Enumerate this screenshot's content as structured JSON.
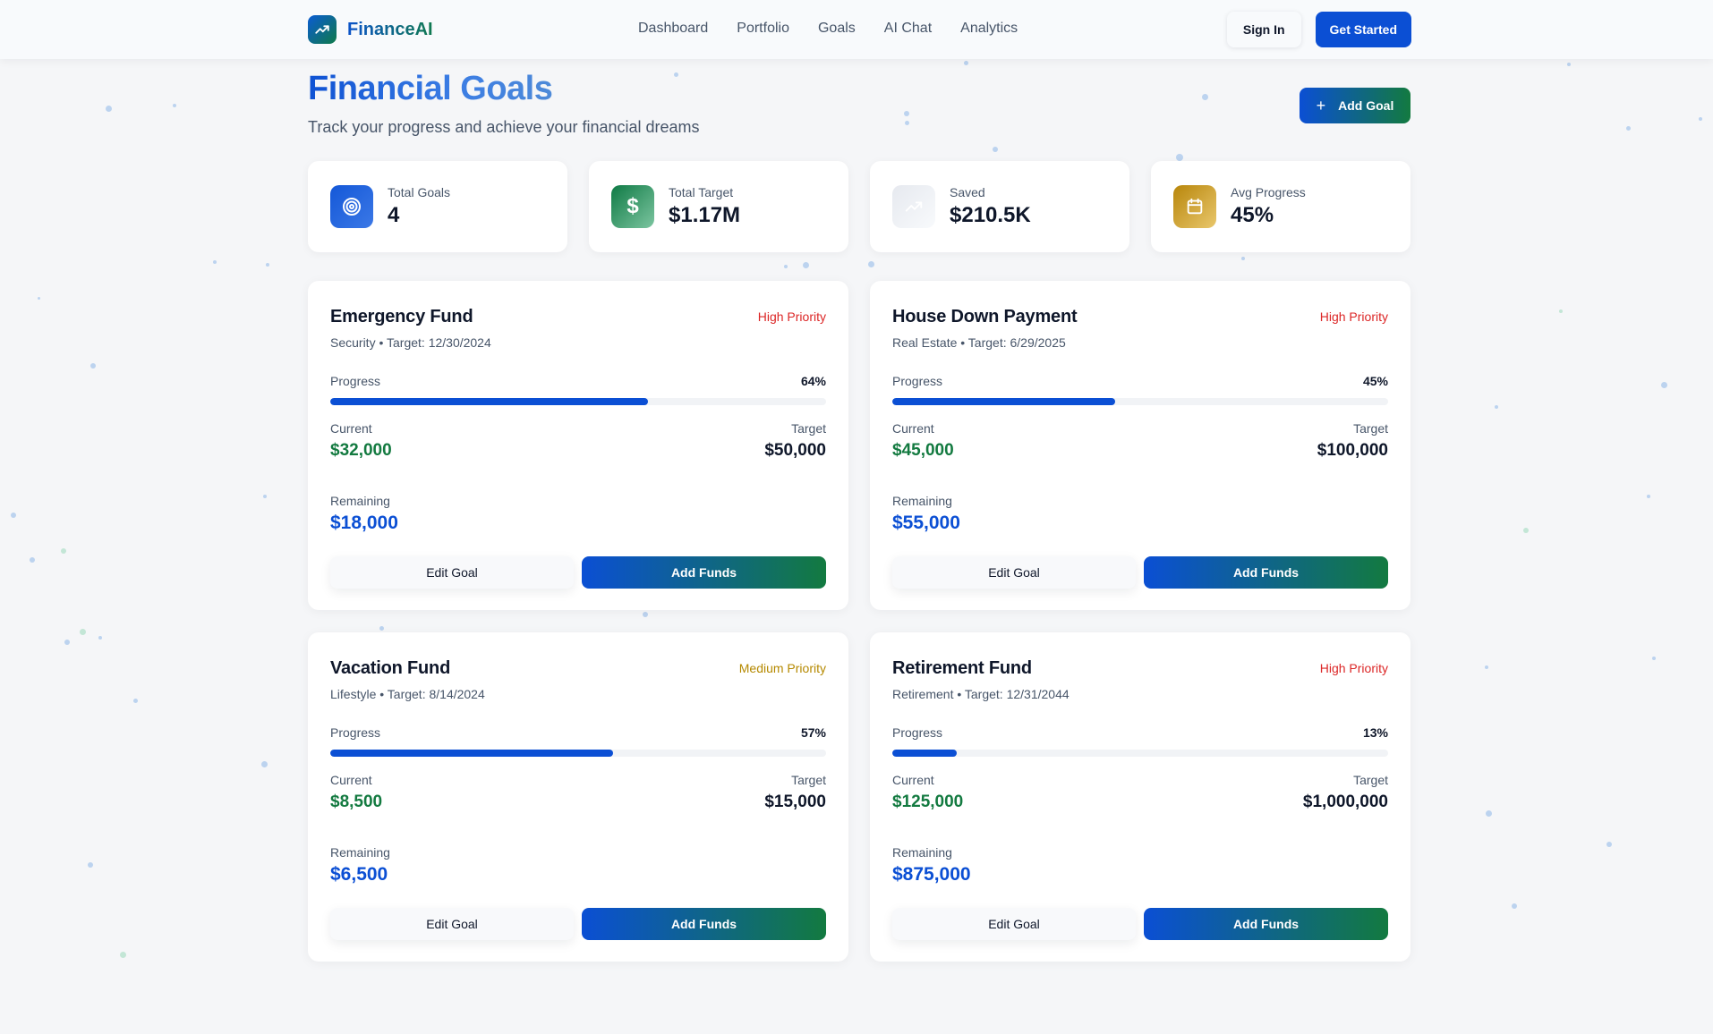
{
  "nav": {
    "brand": "FinanceAI",
    "links": [
      "Dashboard",
      "Portfolio",
      "Goals",
      "AI Chat",
      "Analytics"
    ],
    "sign_in": "Sign In",
    "get_started": "Get Started"
  },
  "header": {
    "title": "Financial Goals",
    "subtitle": "Track your progress and achieve your financial dreams",
    "add_goal": "Add Goal"
  },
  "stats": [
    {
      "label": "Total Goals",
      "value": "4",
      "icon": "target-icon"
    },
    {
      "label": "Total Target",
      "value": "$1.17M",
      "icon": "dollar-icon"
    },
    {
      "label": "Saved",
      "value": "$210.5K",
      "icon": "trending-up-icon"
    },
    {
      "label": "Avg Progress",
      "value": "45%",
      "icon": "calendar-icon"
    }
  ],
  "goals": [
    {
      "name": "Emergency Fund",
      "priority": "High Priority",
      "priority_color": "#dc2626",
      "meta": "Security • Target: 12/30/2024",
      "progress_label": "Progress",
      "progress_pct": "64%",
      "progress": 0.64,
      "current_label": "Current",
      "current": "$32,000",
      "target_label": "Target",
      "target": "$50,000",
      "remaining_label": "Remaining",
      "remaining": "$18,000",
      "edit": "Edit Goal",
      "fund": "Add Funds"
    },
    {
      "name": "House Down Payment",
      "priority": "High Priority",
      "priority_color": "#dc2626",
      "meta": "Real Estate • Target: 6/29/2025",
      "progress_label": "Progress",
      "progress_pct": "45%",
      "progress": 0.45,
      "current_label": "Current",
      "current": "$45,000",
      "target_label": "Target",
      "target": "$100,000",
      "remaining_label": "Remaining",
      "remaining": "$55,000",
      "edit": "Edit Goal",
      "fund": "Add Funds"
    },
    {
      "name": "Vacation Fund",
      "priority": "Medium Priority",
      "priority_color": "#b58900",
      "meta": "Lifestyle • Target: 8/14/2024",
      "progress_label": "Progress",
      "progress_pct": "57%",
      "progress": 0.57,
      "current_label": "Current",
      "current": "$8,500",
      "target_label": "Target",
      "target": "$15,000",
      "remaining_label": "Remaining",
      "remaining": "$6,500",
      "edit": "Edit Goal",
      "fund": "Add Funds"
    },
    {
      "name": "Retirement Fund",
      "priority": "High Priority",
      "priority_color": "#dc2626",
      "meta": "Retirement • Target: 12/31/2044",
      "progress_label": "Progress",
      "progress_pct": "13%",
      "progress": 0.13,
      "current_label": "Current",
      "current": "$125,000",
      "target_label": "Target",
      "target": "$1,000,000",
      "remaining_label": "Remaining",
      "remaining": "$875,000",
      "edit": "Edit Goal",
      "fund": "Add Funds"
    }
  ],
  "colors": {
    "accent_blue": "#0b4fd4",
    "accent_green": "#137a40",
    "high_priority": "#dc2626",
    "medium_priority": "#b58900"
  }
}
